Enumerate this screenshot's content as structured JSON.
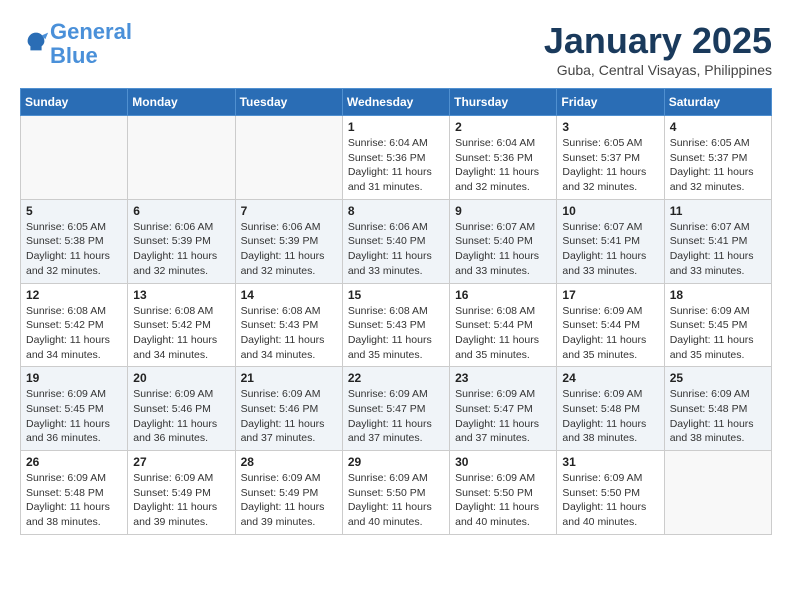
{
  "header": {
    "logo_line1": "General",
    "logo_line2": "Blue",
    "month_title": "January 2025",
    "location": "Guba, Central Visayas, Philippines"
  },
  "weekdays": [
    "Sunday",
    "Monday",
    "Tuesday",
    "Wednesday",
    "Thursday",
    "Friday",
    "Saturday"
  ],
  "weeks": [
    [
      {
        "day": "",
        "sunrise": "",
        "sunset": "",
        "daylight": ""
      },
      {
        "day": "",
        "sunrise": "",
        "sunset": "",
        "daylight": ""
      },
      {
        "day": "",
        "sunrise": "",
        "sunset": "",
        "daylight": ""
      },
      {
        "day": "1",
        "sunrise": "Sunrise: 6:04 AM",
        "sunset": "Sunset: 5:36 PM",
        "daylight": "Daylight: 11 hours and 31 minutes."
      },
      {
        "day": "2",
        "sunrise": "Sunrise: 6:04 AM",
        "sunset": "Sunset: 5:36 PM",
        "daylight": "Daylight: 11 hours and 32 minutes."
      },
      {
        "day": "3",
        "sunrise": "Sunrise: 6:05 AM",
        "sunset": "Sunset: 5:37 PM",
        "daylight": "Daylight: 11 hours and 32 minutes."
      },
      {
        "day": "4",
        "sunrise": "Sunrise: 6:05 AM",
        "sunset": "Sunset: 5:37 PM",
        "daylight": "Daylight: 11 hours and 32 minutes."
      }
    ],
    [
      {
        "day": "5",
        "sunrise": "Sunrise: 6:05 AM",
        "sunset": "Sunset: 5:38 PM",
        "daylight": "Daylight: 11 hours and 32 minutes."
      },
      {
        "day": "6",
        "sunrise": "Sunrise: 6:06 AM",
        "sunset": "Sunset: 5:39 PM",
        "daylight": "Daylight: 11 hours and 32 minutes."
      },
      {
        "day": "7",
        "sunrise": "Sunrise: 6:06 AM",
        "sunset": "Sunset: 5:39 PM",
        "daylight": "Daylight: 11 hours and 32 minutes."
      },
      {
        "day": "8",
        "sunrise": "Sunrise: 6:06 AM",
        "sunset": "Sunset: 5:40 PM",
        "daylight": "Daylight: 11 hours and 33 minutes."
      },
      {
        "day": "9",
        "sunrise": "Sunrise: 6:07 AM",
        "sunset": "Sunset: 5:40 PM",
        "daylight": "Daylight: 11 hours and 33 minutes."
      },
      {
        "day": "10",
        "sunrise": "Sunrise: 6:07 AM",
        "sunset": "Sunset: 5:41 PM",
        "daylight": "Daylight: 11 hours and 33 minutes."
      },
      {
        "day": "11",
        "sunrise": "Sunrise: 6:07 AM",
        "sunset": "Sunset: 5:41 PM",
        "daylight": "Daylight: 11 hours and 33 minutes."
      }
    ],
    [
      {
        "day": "12",
        "sunrise": "Sunrise: 6:08 AM",
        "sunset": "Sunset: 5:42 PM",
        "daylight": "Daylight: 11 hours and 34 minutes."
      },
      {
        "day": "13",
        "sunrise": "Sunrise: 6:08 AM",
        "sunset": "Sunset: 5:42 PM",
        "daylight": "Daylight: 11 hours and 34 minutes."
      },
      {
        "day": "14",
        "sunrise": "Sunrise: 6:08 AM",
        "sunset": "Sunset: 5:43 PM",
        "daylight": "Daylight: 11 hours and 34 minutes."
      },
      {
        "day": "15",
        "sunrise": "Sunrise: 6:08 AM",
        "sunset": "Sunset: 5:43 PM",
        "daylight": "Daylight: 11 hours and 35 minutes."
      },
      {
        "day": "16",
        "sunrise": "Sunrise: 6:08 AM",
        "sunset": "Sunset: 5:44 PM",
        "daylight": "Daylight: 11 hours and 35 minutes."
      },
      {
        "day": "17",
        "sunrise": "Sunrise: 6:09 AM",
        "sunset": "Sunset: 5:44 PM",
        "daylight": "Daylight: 11 hours and 35 minutes."
      },
      {
        "day": "18",
        "sunrise": "Sunrise: 6:09 AM",
        "sunset": "Sunset: 5:45 PM",
        "daylight": "Daylight: 11 hours and 35 minutes."
      }
    ],
    [
      {
        "day": "19",
        "sunrise": "Sunrise: 6:09 AM",
        "sunset": "Sunset: 5:45 PM",
        "daylight": "Daylight: 11 hours and 36 minutes."
      },
      {
        "day": "20",
        "sunrise": "Sunrise: 6:09 AM",
        "sunset": "Sunset: 5:46 PM",
        "daylight": "Daylight: 11 hours and 36 minutes."
      },
      {
        "day": "21",
        "sunrise": "Sunrise: 6:09 AM",
        "sunset": "Sunset: 5:46 PM",
        "daylight": "Daylight: 11 hours and 37 minutes."
      },
      {
        "day": "22",
        "sunrise": "Sunrise: 6:09 AM",
        "sunset": "Sunset: 5:47 PM",
        "daylight": "Daylight: 11 hours and 37 minutes."
      },
      {
        "day": "23",
        "sunrise": "Sunrise: 6:09 AM",
        "sunset": "Sunset: 5:47 PM",
        "daylight": "Daylight: 11 hours and 37 minutes."
      },
      {
        "day": "24",
        "sunrise": "Sunrise: 6:09 AM",
        "sunset": "Sunset: 5:48 PM",
        "daylight": "Daylight: 11 hours and 38 minutes."
      },
      {
        "day": "25",
        "sunrise": "Sunrise: 6:09 AM",
        "sunset": "Sunset: 5:48 PM",
        "daylight": "Daylight: 11 hours and 38 minutes."
      }
    ],
    [
      {
        "day": "26",
        "sunrise": "Sunrise: 6:09 AM",
        "sunset": "Sunset: 5:48 PM",
        "daylight": "Daylight: 11 hours and 38 minutes."
      },
      {
        "day": "27",
        "sunrise": "Sunrise: 6:09 AM",
        "sunset": "Sunset: 5:49 PM",
        "daylight": "Daylight: 11 hours and 39 minutes."
      },
      {
        "day": "28",
        "sunrise": "Sunrise: 6:09 AM",
        "sunset": "Sunset: 5:49 PM",
        "daylight": "Daylight: 11 hours and 39 minutes."
      },
      {
        "day": "29",
        "sunrise": "Sunrise: 6:09 AM",
        "sunset": "Sunset: 5:50 PM",
        "daylight": "Daylight: 11 hours and 40 minutes."
      },
      {
        "day": "30",
        "sunrise": "Sunrise: 6:09 AM",
        "sunset": "Sunset: 5:50 PM",
        "daylight": "Daylight: 11 hours and 40 minutes."
      },
      {
        "day": "31",
        "sunrise": "Sunrise: 6:09 AM",
        "sunset": "Sunset: 5:50 PM",
        "daylight": "Daylight: 11 hours and 40 minutes."
      },
      {
        "day": "",
        "sunrise": "",
        "sunset": "",
        "daylight": ""
      }
    ]
  ]
}
